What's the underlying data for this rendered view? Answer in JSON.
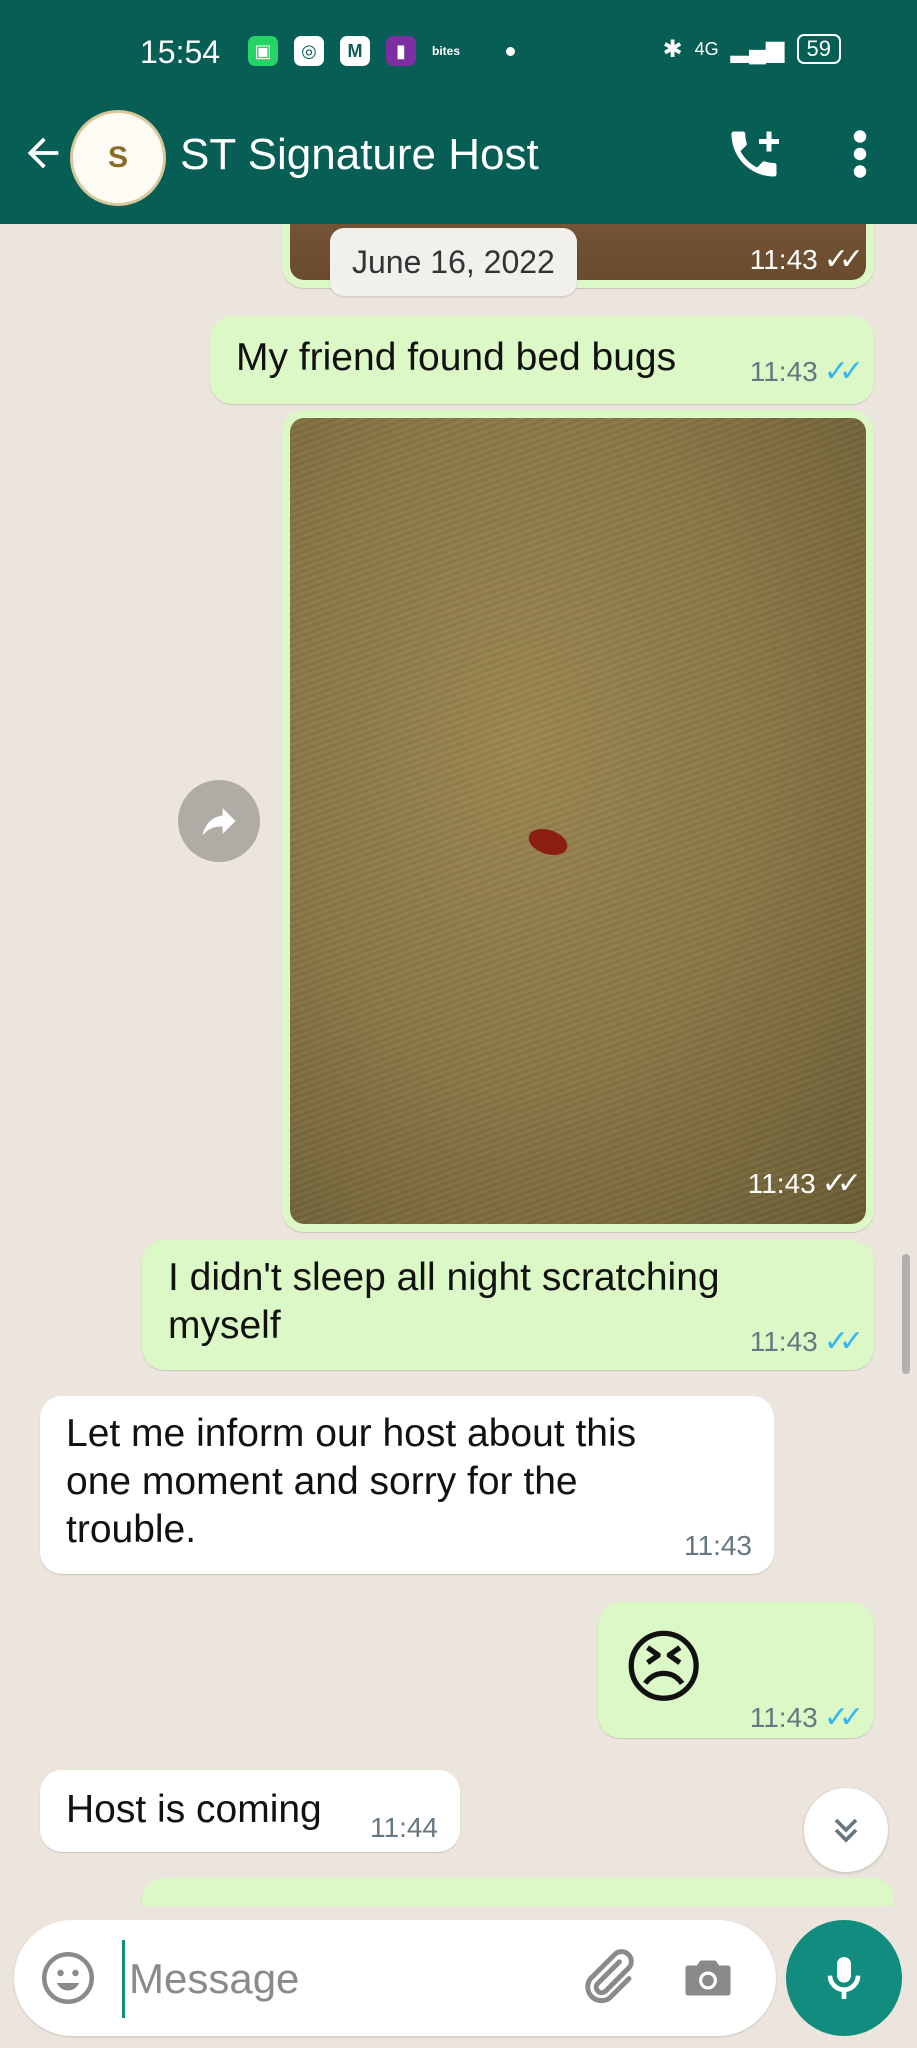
{
  "status_bar": {
    "time": "15:54",
    "app_label": "bites",
    "network": "4G",
    "battery": "59"
  },
  "header": {
    "title": "ST Signature Host",
    "avatar_text": "S"
  },
  "chat": {
    "date_separator": "June 16, 2022",
    "messages": [
      {
        "direction": "out",
        "type": "image",
        "time": "11:43",
        "status": "read"
      },
      {
        "direction": "out",
        "type": "text",
        "text": "My friend found bed bugs",
        "time": "11:43",
        "status": "read"
      },
      {
        "direction": "out",
        "type": "image",
        "time": "11:43",
        "status": "read"
      },
      {
        "direction": "out",
        "type": "text",
        "text": "I didn't sleep all night scratching myself",
        "time": "11:43",
        "status": "read"
      },
      {
        "direction": "in",
        "type": "text",
        "text": "Let me inform our host about this one moment and sorry for the trouble.",
        "time": "11:43"
      },
      {
        "direction": "out",
        "type": "emoji",
        "text": "😣",
        "time": "11:43",
        "status": "read"
      },
      {
        "direction": "in",
        "type": "text",
        "text": "Host is coming",
        "time": "11:44"
      }
    ]
  },
  "composer": {
    "placeholder": "Message"
  },
  "colors": {
    "header": "#075e54",
    "outgoing_bubble": "#dcf8c6",
    "incoming_bubble": "#ffffff",
    "accent": "#128c7e",
    "read_ticks": "#34b7f1"
  },
  "icons": [
    "back-arrow-icon",
    "add-call-icon",
    "more-vert-icon",
    "forward-icon",
    "scroll-down-icon",
    "emoji-icon",
    "attach-icon",
    "camera-icon",
    "mic-icon"
  ]
}
